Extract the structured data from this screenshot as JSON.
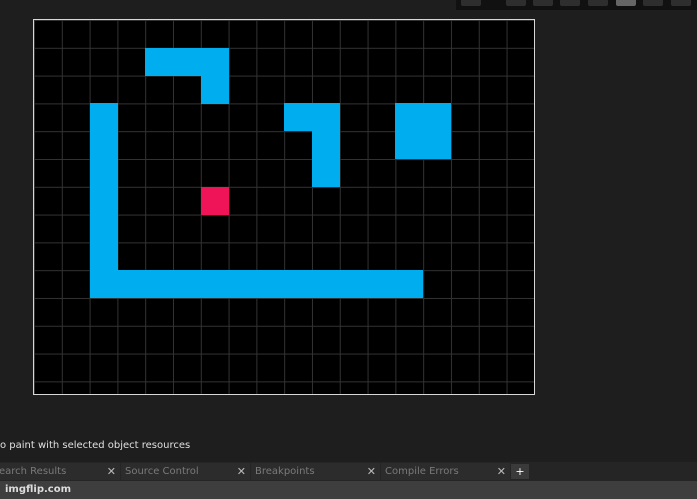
{
  "colors": {
    "wall": "#00adef",
    "player": "#ef1457",
    "background": "#000000"
  },
  "status": "o paint with selected object resources",
  "tabs": [
    {
      "label": "earch Results"
    },
    {
      "label": "Source Control"
    },
    {
      "label": "Breakpoints"
    },
    {
      "label": "Compile Errors"
    }
  ],
  "add_tab": "+",
  "close_glyph": "✕",
  "watermark": "imgflip.com",
  "grid": {
    "cols": 18,
    "rows": 13,
    "wall_cells": [
      [
        4,
        1
      ],
      [
        5,
        1
      ],
      [
        6,
        1
      ],
      [
        6,
        2
      ],
      [
        2,
        3
      ],
      [
        2,
        4
      ],
      [
        2,
        5
      ],
      [
        2,
        6
      ],
      [
        2,
        7
      ],
      [
        2,
        8
      ],
      [
        2,
        9
      ],
      [
        3,
        9
      ],
      [
        4,
        9
      ],
      [
        5,
        9
      ],
      [
        6,
        9
      ],
      [
        7,
        9
      ],
      [
        8,
        9
      ],
      [
        9,
        9
      ],
      [
        10,
        9
      ],
      [
        11,
        9
      ],
      [
        12,
        9
      ],
      [
        13,
        9
      ],
      [
        9,
        3
      ],
      [
        10,
        3
      ],
      [
        10,
        4
      ],
      [
        10,
        5
      ],
      [
        13,
        3
      ],
      [
        14,
        3
      ],
      [
        13,
        4
      ],
      [
        14,
        4
      ]
    ],
    "player_cells": [
      [
        6,
        6
      ]
    ]
  }
}
